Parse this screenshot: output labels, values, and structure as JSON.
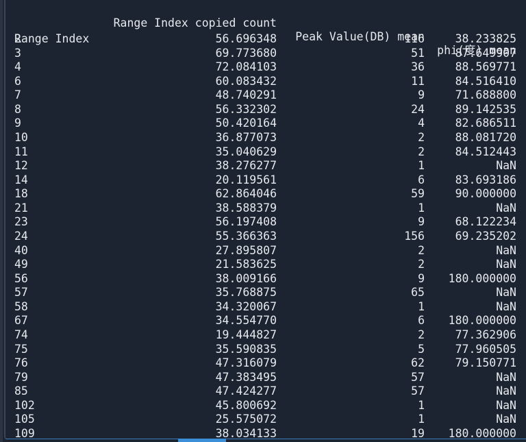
{
  "header": {
    "col1": "Range Index copied count",
    "col2": "Peak Value(DB) mean",
    "col3": "phi(度) mean",
    "index_name": "Range Index"
  },
  "rows": [
    [
      "2",
      "56.696348",
      "116",
      "38.233825"
    ],
    [
      "3",
      "69.773680",
      "51",
      "87.649907"
    ],
    [
      "4",
      "72.084103",
      "36",
      "88.569771"
    ],
    [
      "6",
      "60.083432",
      "11",
      "84.516410"
    ],
    [
      "7",
      "48.740291",
      "9",
      "71.688800"
    ],
    [
      "8",
      "56.332302",
      "24",
      "89.142535"
    ],
    [
      "9",
      "50.420164",
      "4",
      "82.686511"
    ],
    [
      "10",
      "36.877073",
      "2",
      "88.081720"
    ],
    [
      "11",
      "35.040629",
      "2",
      "84.512443"
    ],
    [
      "12",
      "38.276277",
      "1",
      "NaN"
    ],
    [
      "14",
      "20.119561",
      "6",
      "83.693186"
    ],
    [
      "18",
      "62.864046",
      "59",
      "90.000000"
    ],
    [
      "21",
      "38.588379",
      "1",
      "NaN"
    ],
    [
      "23",
      "56.197408",
      "9",
      "68.122234"
    ],
    [
      "24",
      "55.366363",
      "156",
      "69.235202"
    ],
    [
      "40",
      "27.895807",
      "2",
      "NaN"
    ],
    [
      "49",
      "21.583625",
      "2",
      "NaN"
    ],
    [
      "56",
      "38.009166",
      "9",
      "180.000000"
    ],
    [
      "57",
      "35.768875",
      "65",
      "NaN"
    ],
    [
      "58",
      "34.320067",
      "1",
      "NaN"
    ],
    [
      "67",
      "34.554770",
      "6",
      "180.000000"
    ],
    [
      "74",
      "19.444827",
      "2",
      "77.362906"
    ],
    [
      "75",
      "35.590835",
      "5",
      "77.960505"
    ],
    [
      "76",
      "47.316079",
      "62",
      "79.150771"
    ],
    [
      "79",
      "47.383495",
      "57",
      "NaN"
    ],
    [
      "85",
      "47.424277",
      "57",
      "NaN"
    ],
    [
      "102",
      "45.800692",
      "1",
      "NaN"
    ],
    [
      "105",
      "25.575072",
      "1",
      "NaN"
    ],
    [
      "109",
      "38.034133",
      "19",
      "180.000000"
    ]
  ],
  "colors": {
    "background": "#1b2430",
    "text": "#e6e9ee",
    "accent": "#3b8fd8"
  }
}
